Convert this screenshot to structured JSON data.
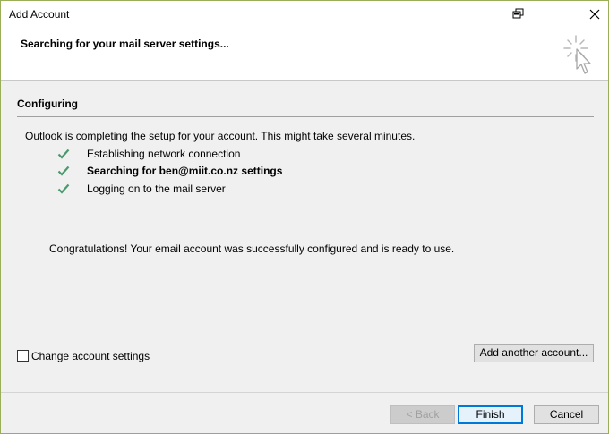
{
  "window": {
    "title": "Add Account"
  },
  "header": {
    "status": "Searching for your mail server settings..."
  },
  "section": {
    "title": "Configuring"
  },
  "content": {
    "intro": "Outlook is completing the setup for your account. This might take several minutes.",
    "steps": [
      {
        "label": "Establishing network connection",
        "status": "done"
      },
      {
        "label": "Searching for ben@miit.co.nz settings",
        "status": "done"
      },
      {
        "label": "Logging on to the mail server",
        "status": "done"
      }
    ],
    "congrats": "Congratulations! Your email account was successfully configured and is ready to use."
  },
  "options": {
    "change_settings_label": "Change account settings",
    "change_settings_checked": false,
    "add_another_label": "Add another account..."
  },
  "footer": {
    "back_label": "< Back",
    "finish_label": "Finish",
    "cancel_label": "Cancel"
  },
  "colors": {
    "check": "#4a9a6e",
    "frame_border": "#9aae57",
    "default_button_border": "#0078d7"
  },
  "icons": {
    "restore": "restore-window-icon",
    "close": "close-icon",
    "busy": "busy-cursor-icon",
    "check": "checkmark-icon"
  }
}
